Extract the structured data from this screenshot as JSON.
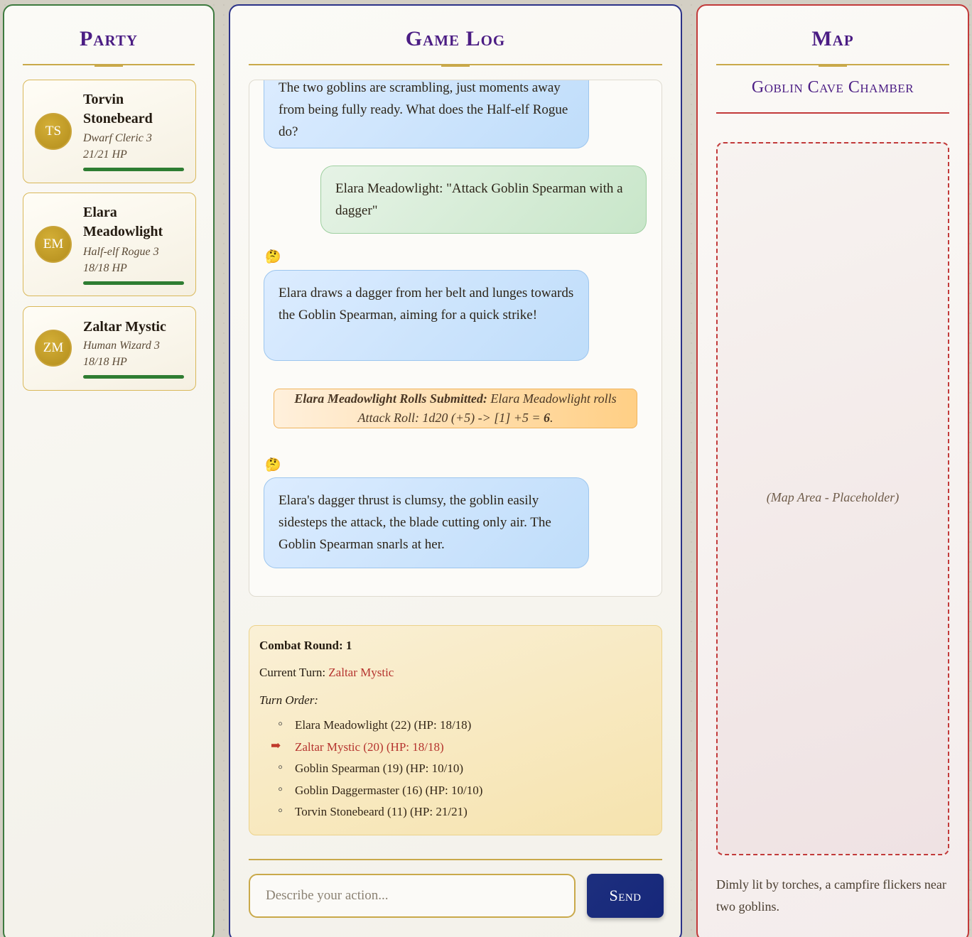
{
  "party": {
    "title": "Party",
    "members": [
      {
        "initials": "TS",
        "name": "Torvin Stonebeard",
        "class": "Dwarf Cleric 3",
        "hp": "21/21 HP",
        "hp_fraction": 1.0
      },
      {
        "initials": "EM",
        "name": "Elara Meadowlight",
        "class": "Half-elf Rogue 3",
        "hp": "18/18 HP",
        "hp_fraction": 1.0
      },
      {
        "initials": "ZM",
        "name": "Zaltar Mystic",
        "class": "Human Wizard 3",
        "hp": "18/18 HP",
        "hp_fraction": 1.0
      }
    ]
  },
  "log": {
    "title": "Game Log",
    "messages": [
      {
        "type": "dm",
        "text": "The two goblins are scrambling, just moments away from being fully ready. What does the Half-elf Rogue do?"
      },
      {
        "type": "player",
        "text": "Elara Meadowlight: \"Attack Goblin Spearman with a dagger\""
      },
      {
        "type": "dm",
        "icon": "thinking-face-emoji",
        "emoji": "🤔",
        "text": "Elara draws a dagger from her belt and lunges towards the Goblin Spearman, aiming for a quick strike!"
      },
      {
        "type": "roll",
        "label": "Elara Meadowlight Rolls Submitted:",
        "text": "Elara Meadowlight rolls",
        "detail": "Attack Roll: 1d20 (+5) -> [1] +5 = ",
        "total": "6",
        "end": "."
      },
      {
        "type": "dm",
        "icon": "thinking-face-emoji",
        "emoji": "🤔",
        "text": "Elara's dagger thrust is clumsy, the goblin easily sidesteps the attack, the blade cutting only air. The Goblin Spearman snarls at her."
      }
    ],
    "combat": {
      "round_label": "Combat Round: 1",
      "current_turn_label": "Current Turn: ",
      "current_turn": "Zaltar Mystic",
      "turn_order_label": "Turn Order:",
      "turn_order": [
        {
          "text": "Elara Meadowlight (22) (HP: 18/18)",
          "active": false
        },
        {
          "text": "Zaltar Mystic (20) (HP: 18/18)",
          "active": true
        },
        {
          "text": "Goblin Spearman (19) (HP: 10/10)",
          "active": false
        },
        {
          "text": "Goblin Daggermaster (16) (HP: 10/10)",
          "active": false
        },
        {
          "text": "Torvin Stonebeard (11) (HP: 21/21)",
          "active": false
        }
      ]
    },
    "input": {
      "placeholder": "Describe your action...",
      "value": ""
    },
    "send_label": "Send"
  },
  "map": {
    "title": "Map",
    "location": "Goblin Cave Chamber",
    "placeholder": "(Map Area - Placeholder)",
    "description": "Dimly lit by torches, a campfire flickers near two goblins."
  },
  "colors": {
    "party_border": "#3d7a3f",
    "log_border": "#2b3288",
    "map_border": "#c23a3a",
    "title_purple": "#4b1d84",
    "gold": "#c9a94a",
    "hp_green": "#2e7d32",
    "current_turn_red": "#b5332e"
  }
}
